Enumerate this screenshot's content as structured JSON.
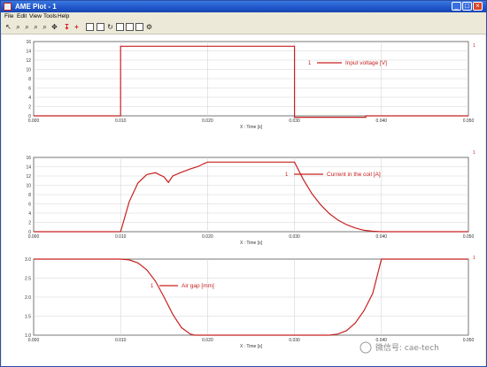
{
  "window": {
    "title": "AME Plot - 1",
    "minimize_glyph": "_",
    "maximize_glyph": "□",
    "close_glyph": "×"
  },
  "menu": [
    "File",
    "Edit",
    "View",
    "Tools",
    "Help"
  ],
  "toolbar": {
    "icons": [
      "pointer-icon",
      "zoom-icon",
      "zoom-in-icon",
      "zoom-out-icon",
      "zoom-fit-icon",
      "pan-icon",
      "red-marker-icon",
      "red-plus-icon",
      "frame-icon",
      "data-icon",
      "refresh-icon",
      "copy-icon",
      "print-icon",
      "export-icon",
      "settings-icon"
    ]
  },
  "colors": {
    "curve": "#c82020",
    "grid": "#d4d4d4",
    "axis": "#555555"
  },
  "chart_data": [
    {
      "type": "line",
      "xlabel": "X : Time [s]",
      "x_ticks": [
        "0.000",
        "0.010",
        "0.020",
        "0.030",
        "0.040",
        "0.050"
      ],
      "xlim": [
        0,
        0.05
      ],
      "ylim": [
        0,
        16
      ],
      "y_ticks": [
        "0",
        "2",
        "4",
        "6",
        "8",
        "10",
        "12",
        "14",
        "16"
      ],
      "legend_position": "top-right",
      "right_marker": "1",
      "series": [
        {
          "name": "Input voltage [V]",
          "legend_index": "1",
          "x": [
            0,
            0.01,
            0.01,
            0.03,
            0.03,
            0.0382,
            0.0382,
            0.05
          ],
          "y": [
            0,
            0,
            15,
            15,
            -0.3,
            -0.3,
            0,
            0
          ]
        }
      ]
    },
    {
      "type": "line",
      "xlabel": "X : Time [s]",
      "x_ticks": [
        "0.000",
        "0.010",
        "0.020",
        "0.030",
        "0.040",
        "0.050"
      ],
      "xlim": [
        0,
        0.05
      ],
      "ylim": [
        0,
        16
      ],
      "y_ticks": [
        "0",
        "2",
        "4",
        "6",
        "8",
        "10",
        "12",
        "14",
        "16"
      ],
      "legend_position": "right",
      "right_marker": "1",
      "series": [
        {
          "name": "Current in the coil [A]",
          "legend_index": "1",
          "x": [
            0,
            0.01,
            0.011,
            0.012,
            0.013,
            0.014,
            0.015,
            0.0155,
            0.016,
            0.017,
            0.018,
            0.019,
            0.0195,
            0.02,
            0.025,
            0.03,
            0.031,
            0.032,
            0.033,
            0.034,
            0.035,
            0.036,
            0.037,
            0.038,
            0.039,
            0.04,
            0.05
          ],
          "y": [
            0,
            0,
            6.5,
            10.5,
            12.3,
            12.7,
            11.8,
            10.6,
            12,
            12.8,
            13.5,
            14.1,
            14.6,
            15,
            15,
            15,
            11.3,
            8.2,
            5.8,
            3.9,
            2.5,
            1.5,
            0.8,
            0.3,
            0.1,
            0,
            0
          ]
        }
      ]
    },
    {
      "type": "line",
      "xlabel": "X : Time [s]",
      "x_ticks": [
        "0.000",
        "0.010",
        "0.020",
        "0.030",
        "0.040",
        "0.050"
      ],
      "xlim": [
        0,
        0.05
      ],
      "ylim": [
        1,
        3
      ],
      "y_ticks": [
        "1.0",
        "1.5",
        "2.0",
        "2.5",
        "3.0"
      ],
      "legend_position": "middle-left",
      "right_marker": "1",
      "series": [
        {
          "name": "Air gap [mm]",
          "legend_index": "1",
          "x": [
            0,
            0.01,
            0.011,
            0.012,
            0.013,
            0.014,
            0.015,
            0.016,
            0.017,
            0.018,
            0.0185,
            0.034,
            0.035,
            0.036,
            0.037,
            0.038,
            0.039,
            0.04,
            0.05
          ],
          "y": [
            3,
            3,
            2.98,
            2.9,
            2.72,
            2.42,
            2.0,
            1.55,
            1.2,
            1.03,
            1.0,
            1.0,
            1.03,
            1.12,
            1.32,
            1.65,
            2.1,
            3.0,
            3.0
          ]
        }
      ]
    }
  ],
  "watermark": "微信号: cae-tech"
}
